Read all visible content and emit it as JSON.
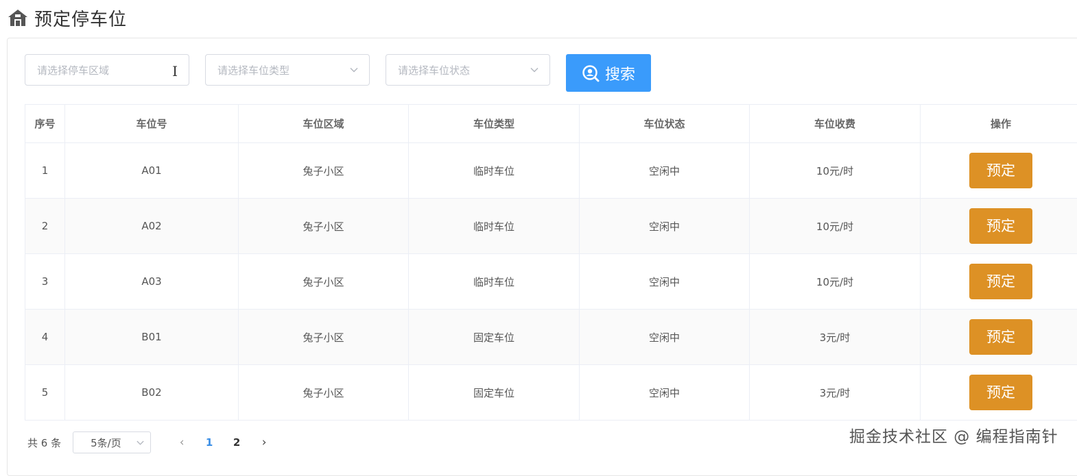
{
  "header": {
    "title": "预定停车位",
    "icon": "parking-home-icon"
  },
  "filters": {
    "area": {
      "placeholder": "请选择停车区域"
    },
    "type": {
      "placeholder": "请选择车位类型"
    },
    "status": {
      "placeholder": "请选择车位状态"
    }
  },
  "search": {
    "label": "搜索",
    "icon": "search-icon"
  },
  "table": {
    "columns": [
      "序号",
      "车位号",
      "车位区域",
      "车位类型",
      "车位状态",
      "车位收费",
      "操作"
    ],
    "rows": [
      {
        "index": "1",
        "spot": "A01",
        "area": "兔子小区",
        "type": "临时车位",
        "status": "空闲中",
        "fee": "10元/时",
        "action": "预定"
      },
      {
        "index": "2",
        "spot": "A02",
        "area": "兔子小区",
        "type": "临时车位",
        "status": "空闲中",
        "fee": "10元/时",
        "action": "预定"
      },
      {
        "index": "3",
        "spot": "A03",
        "area": "兔子小区",
        "type": "临时车位",
        "status": "空闲中",
        "fee": "10元/时",
        "action": "预定"
      },
      {
        "index": "4",
        "spot": "B01",
        "area": "兔子小区",
        "type": "固定车位",
        "status": "空闲中",
        "fee": "3元/时",
        "action": "预定"
      },
      {
        "index": "5",
        "spot": "B02",
        "area": "兔子小区",
        "type": "固定车位",
        "status": "空闲中",
        "fee": "3元/时",
        "action": "预定"
      }
    ]
  },
  "pagination": {
    "total": "共 6 条",
    "page_size": "5条/页",
    "pages": [
      "1",
      "2"
    ],
    "current": "1",
    "prev": "‹",
    "next": "›"
  },
  "watermark": "掘金技术社区 @ 编程指南针",
  "colors": {
    "primary": "#3a9bfb",
    "book": "#dd9125",
    "active_page": "#3a8ee6"
  }
}
